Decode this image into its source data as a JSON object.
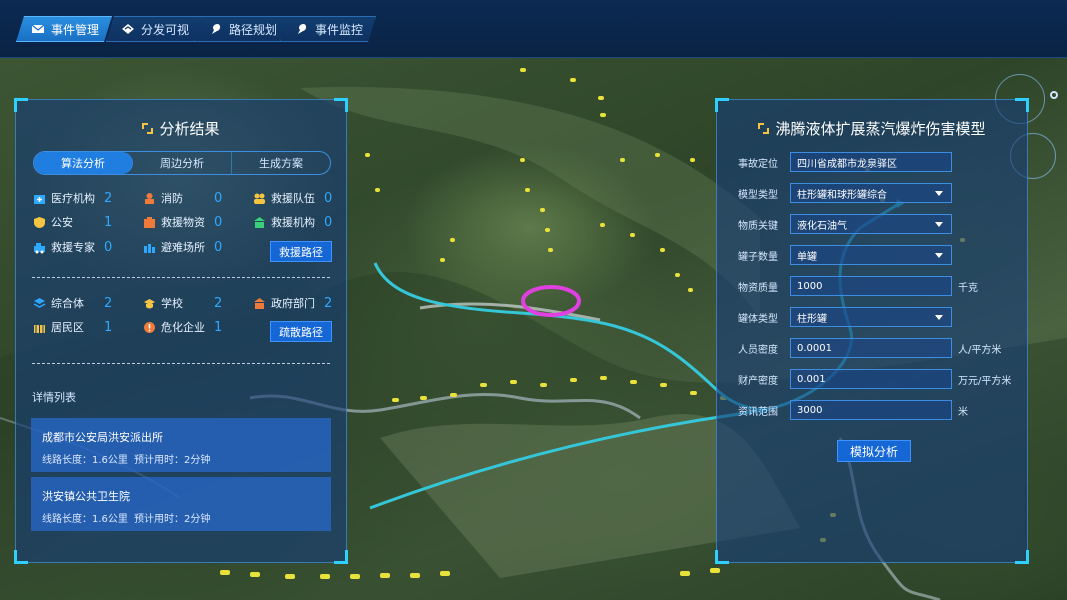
{
  "nav": {
    "tabs": [
      {
        "label": "事件管理",
        "icon": "mail-icon",
        "active": true
      },
      {
        "label": "分发可视",
        "icon": "send-icon",
        "active": false
      },
      {
        "label": "路径规划",
        "icon": "route-icon",
        "active": false
      },
      {
        "label": "事件监控",
        "icon": "monitor-icon",
        "active": false
      }
    ]
  },
  "left_panel": {
    "title": "分析结果",
    "tabs": [
      "算法分析",
      "周边分析",
      "生成方案"
    ],
    "active_tab": "算法分析",
    "stats_rescue": [
      {
        "label": "医疗机构",
        "value": "2",
        "icon": "hospital-icon"
      },
      {
        "label": "消防",
        "value": "0",
        "icon": "fire-station-icon"
      },
      {
        "label": "救援队伍",
        "value": "0",
        "icon": "rescue-team-icon"
      },
      {
        "label": "公安",
        "value": "1",
        "icon": "police-icon"
      },
      {
        "label": "救援物资",
        "value": "0",
        "icon": "supplies-icon"
      },
      {
        "label": "救援机构",
        "value": "0",
        "icon": "rescue-org-icon"
      },
      {
        "label": "救援专家",
        "value": "0",
        "icon": "expert-icon"
      },
      {
        "label": "避难场所",
        "value": "0",
        "icon": "shelter-icon"
      }
    ],
    "rescue_route_button": "救援路径",
    "stats_surrounding": [
      {
        "label": "综合体",
        "value": "2",
        "icon": "complex-icon"
      },
      {
        "label": "学校",
        "value": "2",
        "icon": "school-icon"
      },
      {
        "label": "政府部门",
        "value": "2",
        "icon": "government-icon"
      },
      {
        "label": "居民区",
        "value": "1",
        "icon": "residential-icon"
      },
      {
        "label": "危化企业",
        "value": "1",
        "icon": "hazard-icon"
      }
    ],
    "evacuation_route_button": "疏散路径",
    "detail_label": "详情列表",
    "details": [
      {
        "name": "成都市公安局洪安派出所",
        "length": "线路长度：1.6公里",
        "time": "预计用时：2分钟"
      },
      {
        "name": "洪安镇公共卫生院",
        "length": "线路长度：1.6公里",
        "time": "预计用时：2分钟"
      }
    ]
  },
  "right_panel": {
    "title": "沸腾液体扩展蒸汽爆炸伤害模型",
    "fields": [
      {
        "label": "事故定位",
        "value": "四川省成都市龙泉驿区",
        "type": "input",
        "unit": ""
      },
      {
        "label": "模型类型",
        "value": "柱形罐和球形罐综合",
        "type": "select",
        "unit": ""
      },
      {
        "label": "物质关键",
        "value": "液化石油气",
        "type": "select",
        "unit": ""
      },
      {
        "label": "罐子数量",
        "value": "单罐",
        "type": "select",
        "unit": ""
      },
      {
        "label": "物资质量",
        "value": "1000",
        "type": "input",
        "unit": "千克"
      },
      {
        "label": "罐体类型",
        "value": "柱形罐",
        "type": "select",
        "unit": ""
      },
      {
        "label": "人员密度",
        "value": "0.0001",
        "type": "input",
        "unit": "人/平方米"
      },
      {
        "label": "财产密度",
        "value": "0.001",
        "type": "input",
        "unit": "万元/平方米"
      },
      {
        "label": "资讯范围",
        "value": "3000",
        "type": "input",
        "unit": "米"
      }
    ],
    "simulate_button": "模拟分析"
  },
  "colors": {
    "accent": "#1f7ee0",
    "value_blue": "#2fa8ff",
    "corner_cyan": "#2fd0ff",
    "route_cyan": "#35c6d8",
    "marker_yellow": "#e8e23a",
    "incident_magenta": "#e040e0"
  }
}
